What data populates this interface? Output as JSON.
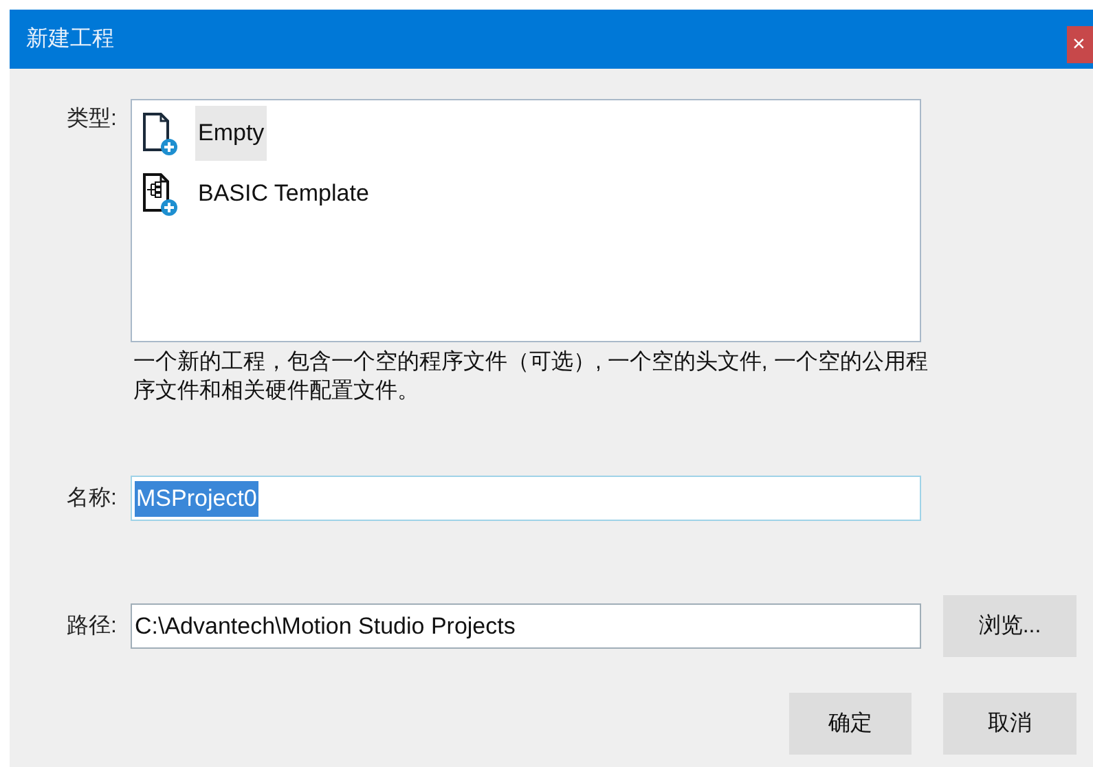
{
  "window": {
    "title": "新建工程",
    "close": "×"
  },
  "type_label": "类型:",
  "templates": [
    {
      "label": "Empty",
      "kind": "empty",
      "selected": true
    },
    {
      "label": "BASIC Template",
      "kind": "template",
      "selected": false
    }
  ],
  "description": "一个新的工程，包含一个空的程序文件（可选）, 一个空的头文件, 一个空的公用程序文件和相关硬件配置文件。",
  "name": {
    "label": "名称:",
    "value": "MSProject0",
    "value_selected": true
  },
  "path": {
    "label": "路径:",
    "value": "C:\\Advantech\\Motion Studio Projects",
    "browse": "浏览..."
  },
  "buttons": [
    "确定",
    "取消"
  ]
}
